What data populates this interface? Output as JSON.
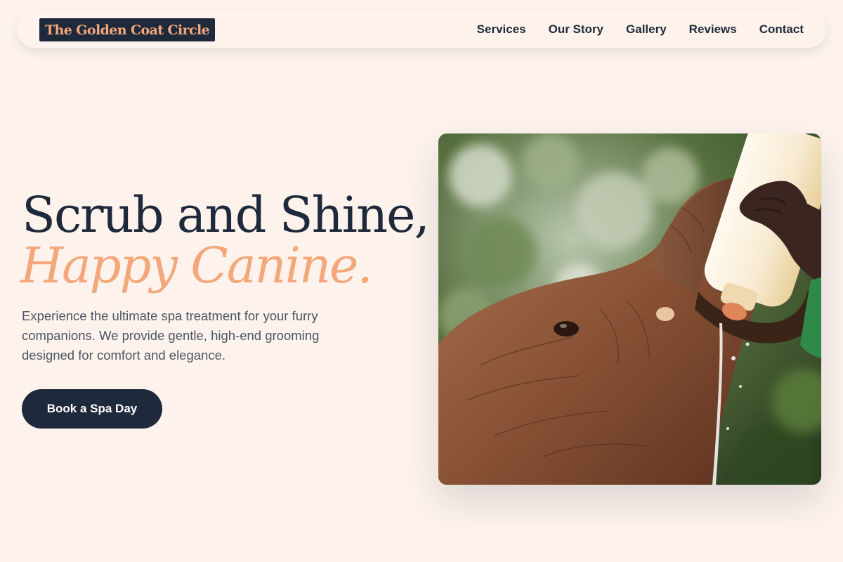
{
  "header": {
    "logo": "The Golden Coat Circle",
    "nav": [
      "Services",
      "Our Story",
      "Gallery",
      "Reviews",
      "Contact"
    ]
  },
  "hero": {
    "headline_line1": "Scrub and Shine,",
    "headline_line2": "Happy Canine.",
    "description": "Experience the ultimate spa treatment for your furry companions. We provide gentle, high-end grooming designed for comfort and elegance.",
    "cta_label": "Book a Spa Day"
  },
  "colors": {
    "background": "#fdf3ec",
    "navy": "#1e293b",
    "accent": "#f4a77a",
    "body_text": "#4b5563"
  }
}
